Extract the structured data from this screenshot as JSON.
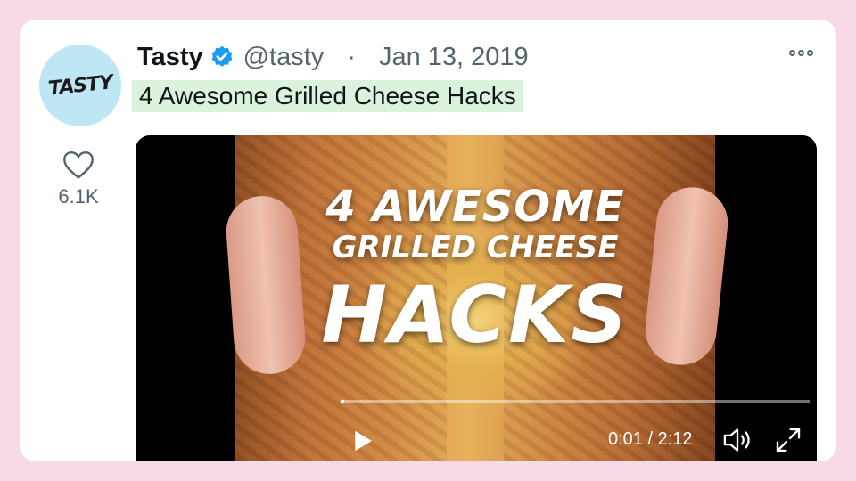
{
  "tweet": {
    "avatar_text": "TASTY",
    "name": "Tasty",
    "handle": "@tasty",
    "separator": "·",
    "date": "Jan 13, 2019",
    "text": "4 Awesome Grilled Cheese Hacks",
    "like_count": "6.1K"
  },
  "video": {
    "overlay_line1": "4 AWESOME",
    "overlay_line2": "GRILLED CHEESE",
    "overlay_line3": "HACKS",
    "time": "0:01 / 2:12",
    "progress_fraction": 0.008
  },
  "icons": [
    "verified-badge-icon",
    "more-options-icon",
    "heart-icon",
    "play-icon",
    "volume-icon",
    "fullscreen-icon"
  ],
  "colors": {
    "background": "#f7d9e8",
    "verified": "#1d9bf0",
    "highlight": "#d9f3dd",
    "secondary_text": "#536471"
  }
}
